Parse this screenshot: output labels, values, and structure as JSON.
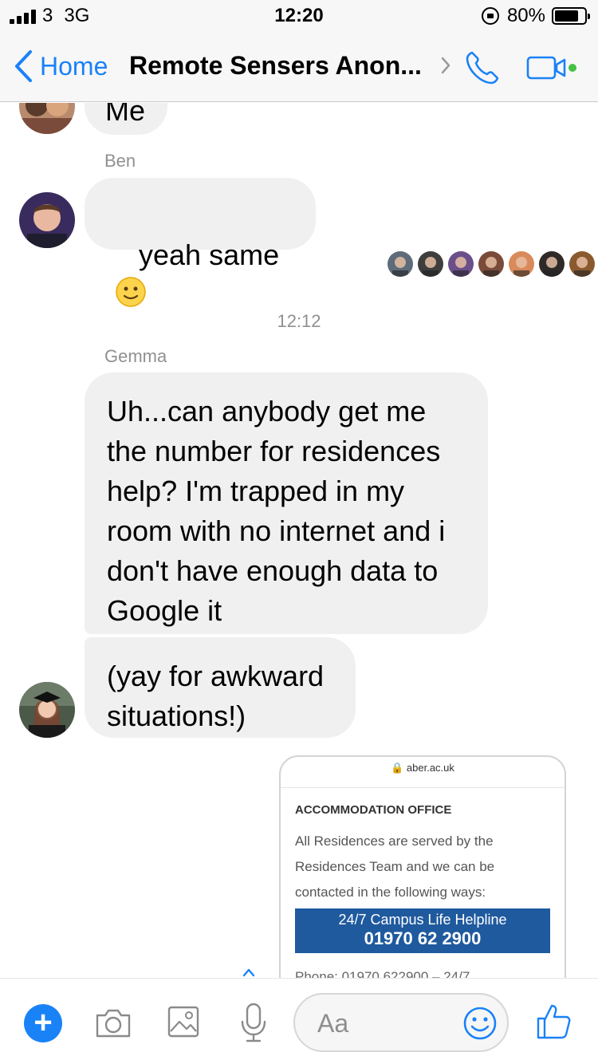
{
  "status_bar": {
    "carrier": "3",
    "network": "3G",
    "time": "12:20",
    "battery": "80%",
    "battery_level": 0.8
  },
  "header": {
    "back_label": "Home",
    "title": "Remote Sensers Anon...",
    "icons": [
      "chevron-left-icon",
      "chevron-right-icon",
      "phone-icon",
      "video-camera-icon"
    ],
    "accent_color": "#1a82f7",
    "online_color": "#44c244"
  },
  "conversation": {
    "partial_message": "Me",
    "messages": [
      {
        "sender": "Ben",
        "text": "yeah same",
        "emoji": "slightly-smiling-face-icon"
      },
      {
        "timestamp": "12:12"
      },
      {
        "sender": "Gemma",
        "text": "Uh...can anybody get me\nthe number for residences\nhelp? I'm trapped in my\nroom with no internet and i\ndon't have enough data to\nGoogle it"
      },
      {
        "text": "(yay for awkward\nsituations!)"
      }
    ],
    "read_receipt_count": 7,
    "shared_image": {
      "url": "aber.ac.uk",
      "heading": "ACCOMMODATION OFFICE",
      "body": "All Residences are served by the Residences Team and we can be contacted in the following ways:",
      "helpline_title": "24/7 Campus Life Helpline",
      "helpline_number": "01970 62 2900",
      "helpline_color": "#1f5a9e",
      "cut_off_text": "Phone: 01970 622900 – 24/7"
    },
    "bubble_color": "#f1f0f0"
  },
  "composer": {
    "placeholder": "Aa",
    "icons": [
      "plus-icon",
      "camera-icon",
      "image-icon",
      "microphone-icon",
      "emoji-icon",
      "thumbs-up-icon"
    ]
  }
}
